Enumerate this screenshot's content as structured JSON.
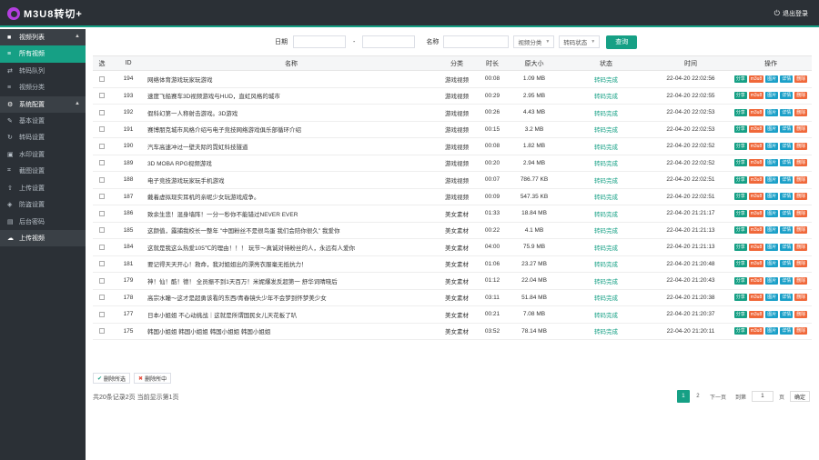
{
  "header": {
    "logo_text": "M3U8转切+",
    "logout_label": "退出登录"
  },
  "sidebar": {
    "groups": [
      {
        "label": "视频列表",
        "items": [
          "所有视频",
          "转码队列",
          "视频分类"
        ]
      },
      {
        "label": "系统配置",
        "items": [
          "基本设置",
          "转码设置",
          "水印设置",
          "截图设置",
          "上传设置",
          "防盗设置",
          "后台密码"
        ]
      }
    ],
    "footer_item": "上传视频"
  },
  "filter": {
    "date_label": "日期",
    "date_sep": "-",
    "name_label": "名称",
    "category_select": "视频分类",
    "status_select": "转码状态",
    "query_button": "查询"
  },
  "table": {
    "headers": [
      "选",
      "ID",
      "名称",
      "分类",
      "时长",
      "原大小",
      "状态",
      "时间",
      "操作"
    ],
    "ops": [
      "分享",
      "m3u8",
      "图片",
      "详情",
      "删除"
    ],
    "rows": [
      {
        "id": "194",
        "name": "网络体育游戏玩家玩游戏",
        "category": "游戏视频",
        "duration": "00:08",
        "size": "1.09 MB",
        "status": "转码完成",
        "time": "22-04-20 22:02:56"
      },
      {
        "id": "193",
        "name": "速度飞船赛车3D视频游戏与HUD，直虹风格的城市",
        "category": "游戏视频",
        "duration": "00:29",
        "size": "2.95 MB",
        "status": "转码完成",
        "time": "22-04-20 22:02:55"
      },
      {
        "id": "192",
        "name": "假科幻第一人称射击游戏。3D游戏",
        "category": "游戏视频",
        "duration": "00:26",
        "size": "4.43 MB",
        "status": "转码完成",
        "time": "22-04-20 22:02:53"
      },
      {
        "id": "191",
        "name": "赛博朋克城市风格介绍与电子竞技网络游戏俱乐部循环介绍",
        "category": "游戏视频",
        "duration": "00:15",
        "size": "3.2 MB",
        "status": "转码完成",
        "time": "22-04-20 22:02:53"
      },
      {
        "id": "190",
        "name": "汽车高速冲过一壁夫际的霓虹科技隧道",
        "category": "游戏视频",
        "duration": "00:08",
        "size": "1.82 MB",
        "status": "转码完成",
        "time": "22-04-20 22:02:52"
      },
      {
        "id": "189",
        "name": "3D MOBA RPG视频游戏",
        "category": "游戏视频",
        "duration": "00:20",
        "size": "2.94 MB",
        "status": "转码完成",
        "time": "22-04-20 22:02:52"
      },
      {
        "id": "188",
        "name": "电子竞技游戏玩家玩手机游戏",
        "category": "游戏视频",
        "duration": "00:07",
        "size": "786.77 KB",
        "status": "转码完成",
        "time": "22-04-20 22:02:51"
      },
      {
        "id": "187",
        "name": "戴着虚拟现实耳机的亲昵少女玩游戏成争。",
        "category": "游戏视频",
        "duration": "00:09",
        "size": "547.35 KB",
        "status": "转码完成",
        "time": "22-04-20 22:02:51"
      },
      {
        "id": "186",
        "name": "致余生悲！混身墙阵！一分一秒你不能错过NEVER EVER",
        "category": "美女素材",
        "duration": "01:33",
        "size": "18.84 MB",
        "status": "转码完成",
        "time": "22-04-20 21:21:17"
      },
      {
        "id": "185",
        "name": "这颜值，露捕我校长一整年 \"中国粉丝不是很鸟蛋 我们会陪你很久\" 我爱你",
        "category": "美女素材",
        "duration": "00:22",
        "size": "4.1 MB",
        "status": "转码完成",
        "time": "22-04-20 21:21:13"
      },
      {
        "id": "184",
        "name": "这就是我这么热爱105℃的理由！！！ 玩节～真诚对待粉丝的人，永远有人爱你",
        "category": "美女素材",
        "duration": "04:00",
        "size": "75.9 MB",
        "status": "转码完成",
        "time": "22-04-20 21:21:13"
      },
      {
        "id": "181",
        "name": "要记得天天开心！救命，我对姐姐出的漂亮衣服毫无抵抗力！",
        "category": "美女素材",
        "duration": "01:06",
        "size": "23.27 MB",
        "status": "转码完成",
        "time": "22-04-20 21:20:48"
      },
      {
        "id": "179",
        "name": "神！仙！酷！德！ 全员振不到1天百万！米妮爆发反超第一 舒华词晴晓后",
        "category": "美女素材",
        "duration": "01:12",
        "size": "22.04 MB",
        "status": "转码完成",
        "time": "22-04-20 21:20:43"
      },
      {
        "id": "178",
        "name": "高宗水瞳～这才是超勇该看的东西/青春镜头少年不会梦到怀梦美少女",
        "category": "美女素材",
        "duration": "03:11",
        "size": "51.84 MB",
        "status": "转码完成",
        "time": "22-04-20 21:20:38"
      },
      {
        "id": "177",
        "name": "日本小姐姐 不心动挑战｜这就是所谓国民女儿天花板了叭",
        "category": "美女素材",
        "duration": "00:21",
        "size": "7.08 MB",
        "status": "转码完成",
        "time": "22-04-20 21:20:37"
      },
      {
        "id": "175",
        "name": "韩国小姐姐 韩国小姐姐 韩国小姐姐 韩国小姐姐",
        "category": "美女素材",
        "duration": "03:52",
        "size": "78.14 MB",
        "status": "转码完成",
        "time": "22-04-20 21:20:11"
      }
    ]
  },
  "bulk": {
    "delete_selected": "删除所选",
    "delete_all": "删除所中"
  },
  "pagination": {
    "summary": "共20条记录2页 当前显示第1页",
    "pages": [
      "1",
      "2"
    ],
    "next": "下一页",
    "goto_label": "到第",
    "page_value": "1",
    "page_unit": "页",
    "confirm": "确定"
  }
}
